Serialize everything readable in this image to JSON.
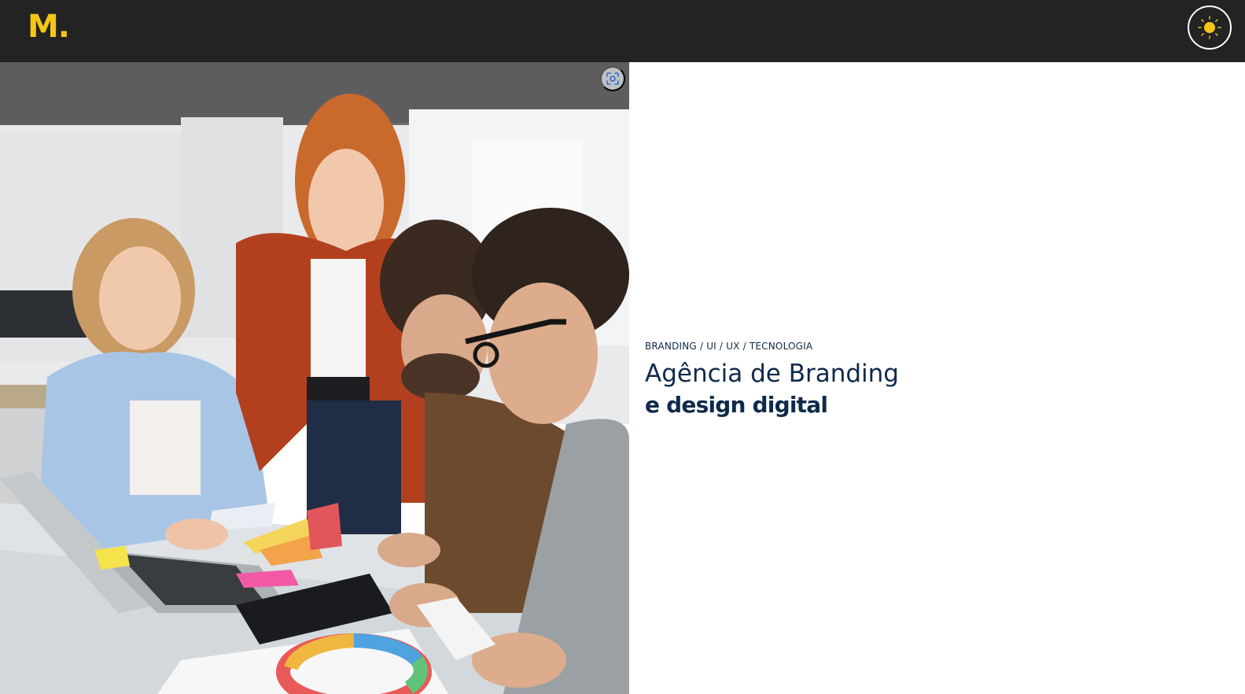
{
  "header": {
    "logo_text": "M.",
    "theme_toggle": {
      "icon": "sun-icon"
    }
  },
  "hero": {
    "image": {
      "icon": "visual-search-icon"
    },
    "tags": "BRANDING / UI / UX / TECNOLOGIA",
    "headline": "Agência de Branding",
    "subheadline": "e design digital"
  },
  "colors": {
    "topbar": "#232323",
    "logo": "#f5c518",
    "sun": "#f5c518",
    "text_navy": "#0f2a4a",
    "background": "#ffffff"
  }
}
